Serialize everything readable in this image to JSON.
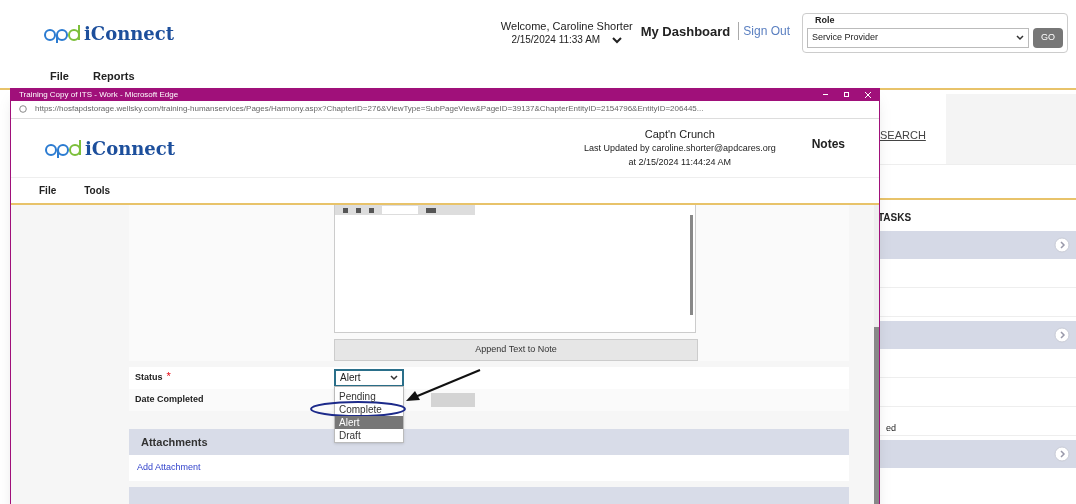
{
  "app": {
    "logo": "iConnect",
    "welcome": "Welcome, Caroline Shorter",
    "datetime": "2/15/2024 11:33 AM",
    "dashboard": "My Dashboard",
    "sign_out": "Sign Out",
    "role_label": "Role",
    "role_value": "Service Provider",
    "go": "GO",
    "menu": [
      "File",
      "Reports"
    ],
    "search_link": "SEARCH",
    "tasks_title": "TASKS",
    "task_text": "ed"
  },
  "popup": {
    "title": "Training Copy of ITS - Work - Microsoft Edge",
    "url": "https://hosfapdstorage.wellsky.com/training-humanservices/Pages/Harmony.aspx?ChapterID=276&ViewType=SubPageView&PageID=39137&ChapterEntityID=2154796&EntityID=206445...",
    "logo": "iConnect",
    "consumer": "Capt'n Crunch",
    "updated_by": "Last Updated by caroline.shorter@apdcares.org",
    "updated_at": "at 2/15/2024 11:44:24 AM",
    "section": "Notes",
    "menu": [
      "File",
      "Tools"
    ],
    "append_button": "Append Text to Note",
    "status": {
      "label": "Status",
      "required_mark": "*",
      "value": "Alert",
      "expanded": true,
      "options": [
        {
          "label": "Pending",
          "selected": false
        },
        {
          "label": "Complete",
          "selected": false
        },
        {
          "label": "Alert",
          "selected": true
        },
        {
          "label": "Draft",
          "selected": false
        }
      ]
    },
    "date_completed": {
      "label": "Date Completed"
    },
    "attachments": {
      "title": "Attachments",
      "link": "Add Attachment"
    }
  }
}
